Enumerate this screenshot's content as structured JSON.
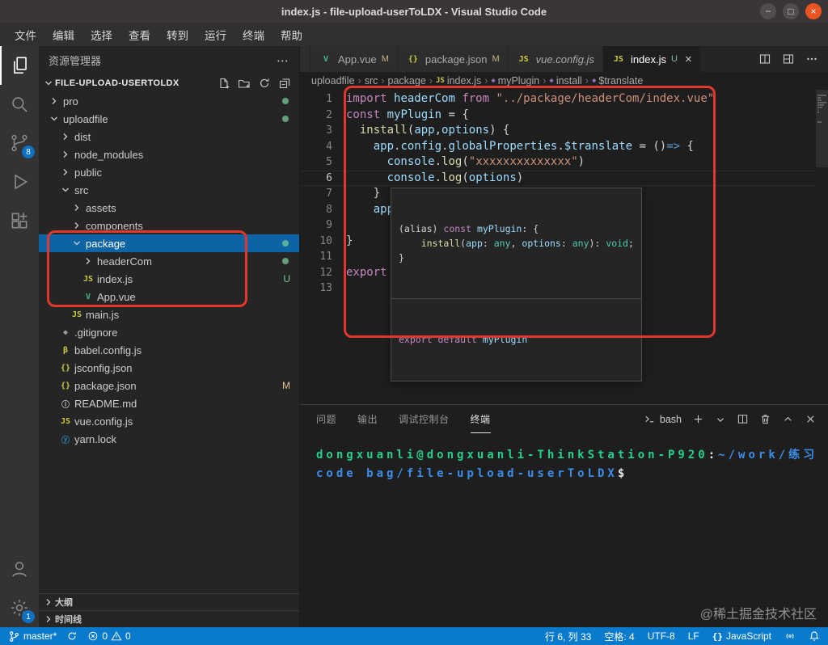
{
  "window": {
    "title": "index.js - file-upload-userToLDX - Visual Studio Code"
  },
  "window_controls": {
    "minimize": "−",
    "maximize": "□",
    "close": "×"
  },
  "colors": {
    "annotation_red": "#e0382c",
    "statusbar_blue": "#0a7acc",
    "selection_blue": "#0d64a5",
    "terminal_green": "#23d18b",
    "terminal_blue": "#3b8eea"
  },
  "menu": {
    "items": [
      {
        "label": "文件",
        "name": "file"
      },
      {
        "label": "编辑",
        "name": "edit"
      },
      {
        "label": "选择",
        "name": "selection"
      },
      {
        "label": "查看",
        "name": "view"
      },
      {
        "label": "转到",
        "name": "go"
      },
      {
        "label": "运行",
        "name": "run"
      },
      {
        "label": "终端",
        "name": "terminal"
      },
      {
        "label": "帮助",
        "name": "help"
      }
    ]
  },
  "activity_bar": {
    "scm_badge": "8",
    "settings_badge": "1"
  },
  "sidebar": {
    "title": "资源管理器",
    "section": "FILE-UPLOAD-USERTOLDX",
    "tree": [
      {
        "label": "pro",
        "level": 0,
        "kind": "folder",
        "badge": "dot"
      },
      {
        "label": "uploadfile",
        "level": 0,
        "kind": "folder-open",
        "badge": "dot"
      },
      {
        "label": "dist",
        "level": 1,
        "kind": "folder"
      },
      {
        "label": "node_modules",
        "level": 1,
        "kind": "folder"
      },
      {
        "label": "public",
        "level": 1,
        "kind": "folder"
      },
      {
        "label": "src",
        "level": 1,
        "kind": "folder-open"
      },
      {
        "label": "assets",
        "level": 2,
        "kind": "folder"
      },
      {
        "label": "components",
        "level": 2,
        "kind": "folder"
      },
      {
        "label": "package",
        "level": 2,
        "kind": "folder-open",
        "selected": true,
        "badge": "dot"
      },
      {
        "label": "headerCom",
        "level": 3,
        "kind": "folder",
        "badge": "dot"
      },
      {
        "label": "index.js",
        "level": 3,
        "kind": "file",
        "icon": "js",
        "badge": "U"
      },
      {
        "label": "App.vue",
        "level": 3,
        "kind": "file",
        "icon": "vue"
      },
      {
        "label": "main.js",
        "level": 2,
        "kind": "file",
        "icon": "js"
      },
      {
        "label": ".gitignore",
        "level": 1,
        "kind": "file",
        "icon": "git"
      },
      {
        "label": "babel.config.js",
        "level": 1,
        "kind": "file",
        "icon": "beta"
      },
      {
        "label": "jsconfig.json",
        "level": 1,
        "kind": "file",
        "icon": "braces"
      },
      {
        "label": "package.json",
        "level": 1,
        "kind": "file",
        "icon": "braces",
        "badge": "M"
      },
      {
        "label": "README.md",
        "level": 1,
        "kind": "file",
        "icon": "info"
      },
      {
        "label": "vue.config.js",
        "level": 1,
        "kind": "file",
        "icon": "js"
      },
      {
        "label": "yarn.lock",
        "level": 1,
        "kind": "file",
        "icon": "yarn"
      }
    ],
    "bottom_sections": [
      "大纲",
      "时间线"
    ]
  },
  "editor_tabs": {
    "tabs": [
      {
        "label": "App.vue",
        "icon": "vue",
        "badge": "M"
      },
      {
        "label": "package.json",
        "icon": "braces",
        "badge": "M"
      },
      {
        "label": "vue.config.js",
        "icon": "js",
        "preview": true
      },
      {
        "label": "index.js",
        "icon": "js",
        "badge": "U",
        "active": true
      }
    ]
  },
  "breadcrumb": [
    {
      "label": "uploadfile"
    },
    {
      "label": "src"
    },
    {
      "label": "package"
    },
    {
      "label": "index.js",
      "icon": "js"
    },
    {
      "label": "myPlugin",
      "icon": "symbol"
    },
    {
      "label": "install",
      "icon": "symbol"
    },
    {
      "label": "$translate",
      "icon": "symbol"
    }
  ],
  "editor": {
    "lines": [
      {
        "n": 1,
        "tokens": [
          [
            "kw",
            "import"
          ],
          [
            "pl",
            " "
          ],
          [
            "id",
            "headerCom"
          ],
          [
            "pl",
            " "
          ],
          [
            "kw",
            "from"
          ],
          [
            "pl",
            " "
          ],
          [
            "str",
            "\"../package/headerCom/index.vue\""
          ]
        ]
      },
      {
        "n": 2,
        "tokens": [
          [
            "kw",
            "const"
          ],
          [
            "pl",
            " "
          ],
          [
            "id",
            "myPlugin"
          ],
          [
            "pl",
            " = {"
          ]
        ]
      },
      {
        "n": 3,
        "tokens": [
          [
            "pl",
            "  "
          ],
          [
            "fn",
            "install"
          ],
          [
            "pl",
            "("
          ],
          [
            "id",
            "app"
          ],
          [
            "pl",
            ","
          ],
          [
            "id",
            "options"
          ],
          [
            "pl",
            ") {"
          ]
        ]
      },
      {
        "n": 4,
        "tokens": [
          [
            "pl",
            "    "
          ],
          [
            "id",
            "app"
          ],
          [
            "pl",
            "."
          ],
          [
            "id",
            "config"
          ],
          [
            "pl",
            "."
          ],
          [
            "id",
            "globalProperties"
          ],
          [
            "pl",
            "."
          ],
          [
            "id",
            "$translate"
          ],
          [
            "pl",
            " = ()"
          ],
          [
            "blu",
            "=>"
          ],
          [
            "pl",
            " {"
          ]
        ]
      },
      {
        "n": 5,
        "tokens": [
          [
            "pl",
            "      "
          ],
          [
            "id",
            "console"
          ],
          [
            "pl",
            "."
          ],
          [
            "fn",
            "log"
          ],
          [
            "pl",
            "("
          ],
          [
            "str",
            "\"xxxxxxxxxxxxxx\""
          ],
          [
            "pl",
            ")"
          ]
        ]
      },
      {
        "n": 6,
        "active": true,
        "tokens": [
          [
            "pl",
            "      "
          ],
          [
            "id",
            "console"
          ],
          [
            "pl",
            "."
          ],
          [
            "fn",
            "log"
          ],
          [
            "pl",
            "("
          ],
          [
            "id",
            "options"
          ],
          [
            "pl",
            ")"
          ]
        ]
      },
      {
        "n": 7,
        "tokens": [
          [
            "pl",
            "    }"
          ]
        ]
      },
      {
        "n": 8,
        "tokens": [
          [
            "pl",
            "    "
          ],
          [
            "id",
            "app"
          ]
        ]
      },
      {
        "n": 9,
        "tokens": []
      },
      {
        "n": 10,
        "tokens": [
          [
            "pl",
            "}"
          ]
        ]
      },
      {
        "n": 11,
        "tokens": []
      },
      {
        "n": 12,
        "tokens": [
          [
            "kw",
            "export"
          ],
          [
            "pl",
            " "
          ],
          [
            "kw hl",
            "default"
          ],
          [
            "pl",
            " "
          ],
          [
            "id",
            "myPlugin"
          ]
        ]
      },
      {
        "n": 13,
        "tokens": []
      }
    ]
  },
  "hover": {
    "lines": [
      [
        [
          "pl",
          "(alias) "
        ],
        [
          "kw",
          "const"
        ],
        [
          "pl",
          " "
        ],
        [
          "id",
          "myPlugin"
        ],
        [
          "pl",
          ": {"
        ]
      ],
      [
        [
          "pl",
          "    "
        ],
        [
          "fn",
          "install"
        ],
        [
          "pl",
          "("
        ],
        [
          "id",
          "app"
        ],
        [
          "pl",
          ": "
        ],
        [
          "ty",
          "any"
        ],
        [
          "pl",
          ", "
        ],
        [
          "id",
          "options"
        ],
        [
          "pl",
          ": "
        ],
        [
          "ty",
          "any"
        ],
        [
          "pl",
          "): "
        ],
        [
          "ty",
          "void"
        ],
        [
          "pl",
          ";"
        ]
      ],
      [
        [
          "pl",
          "}"
        ]
      ]
    ],
    "footer": [
      [
        "kw",
        "export"
      ],
      [
        "pl",
        " "
      ],
      [
        "kw",
        "default"
      ],
      [
        "pl",
        " "
      ],
      [
        "id",
        "myPlugin"
      ]
    ]
  },
  "panel": {
    "tabs": [
      {
        "label": "问题",
        "name": "problems"
      },
      {
        "label": "输出",
        "name": "output"
      },
      {
        "label": "调试控制台",
        "name": "debug-console"
      },
      {
        "label": "终端",
        "name": "terminal",
        "active": true
      }
    ],
    "shell_label": "bash",
    "terminal_lines": [
      [
        [
          "g",
          "dongxuanli@dongxuanli-ThinkStation-P920"
        ],
        [
          "w",
          ":"
        ],
        [
          "b",
          "~/work/练习"
        ]
      ],
      [
        [
          "b",
          "code bag/file-upload-userToLDX"
        ],
        [
          "w",
          "$"
        ]
      ]
    ]
  },
  "status_bar": {
    "branch": "master*",
    "errors": "0",
    "warnings": "0",
    "cursor": "行 6, 列 33",
    "indent": "空格: 4",
    "encoding": "UTF-8",
    "eol": "LF",
    "language_icon": "{}",
    "language": "JavaScript"
  },
  "watermark": "@稀土掘金技术社区"
}
